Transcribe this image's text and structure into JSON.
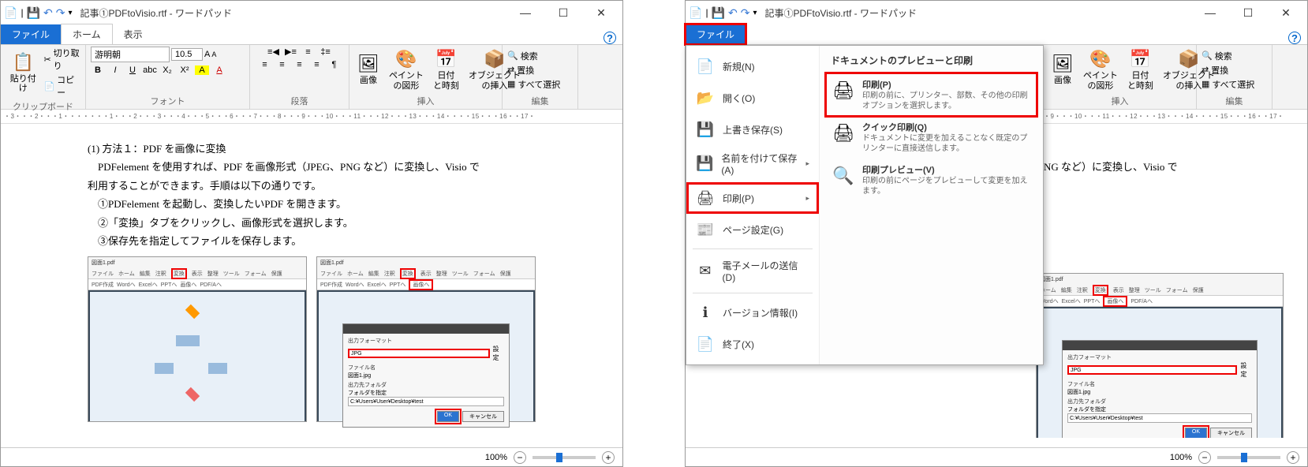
{
  "app_title": "記事①PDFtoVisio.rtf - ワードパッド",
  "tabs": {
    "file": "ファイル",
    "home": "ホーム",
    "view": "表示"
  },
  "ribbon": {
    "clipboard": {
      "paste": "貼り付け",
      "cut": "切り取り",
      "copy": "コピー",
      "label": "クリップボード"
    },
    "font": {
      "name": "游明朝",
      "size": "10.5",
      "label": "フォント"
    },
    "para": {
      "label": "段落"
    },
    "insert": {
      "image": "画像",
      "paint": "ペイント\nの図形",
      "date": "日付\nと時刻",
      "object": "オブジェクト\nの挿入",
      "label": "挿入"
    },
    "edit": {
      "find": "検索",
      "replace": "置換",
      "selectall": "すべて選択",
      "label": "編集"
    }
  },
  "ruler": "・3・・・2・・・1・・・・・・・1・・・2・・・3・・・4・・・5・・・6・・・7・・・8・・・9・・・10・・・11・・・12・・・13・・・14・・・・15・・・16・・17・",
  "doc": {
    "l1": "(1) 方法１：PDF を画像に変換",
    "l2": "　PDFelement を使用すれば、PDF を画像形式（JPEG、PNG など）に変換し、Visio で",
    "l3": "利用することができます。手順は以下の通りです。",
    "l4": "　①PDFelement を起動し、変換したいPDF を開きます。",
    "l5": "　②「変換」タブをクリックし、画像形式を選択します。",
    "l6": "　③保存先を指定してファイルを保存します。"
  },
  "doc2_visible": "NG など）に変換し、Visio で",
  "embed": {
    "title": "図面1.pdf",
    "menus": [
      "ファイル",
      "ホーム",
      "編集",
      "注釈",
      "変換",
      "表示",
      "整理",
      "ツール",
      "フォーム",
      "保護"
    ],
    "btns": [
      "PDF作成",
      "Wordへ",
      "Excelへ",
      "PPTへ",
      "画像へ",
      "PDF/Aへ"
    ],
    "hl_menu": "変換",
    "hl_btn": "画像へ",
    "dlg": {
      "fmt_label": "出力フォーマット",
      "fmt_val": "JPG",
      "fmt_set": "設定",
      "fname_label": "ファイル名",
      "fname_val": "図面1.jpg",
      "folder_label": "出力先フォルダ",
      "folder_opt": "フォルダを指定",
      "folder_val": "C:¥Users¥User¥Desktop¥test",
      "ok": "OK",
      "cancel": "キャンセル"
    }
  },
  "status": {
    "zoom": "100%"
  },
  "filemenu": {
    "right_title": "ドキュメントのプレビューと印刷",
    "items": {
      "new": "新規(N)",
      "open": "開く(O)",
      "save": "上書き保存(S)",
      "saveas": "名前を付けて保存(A)",
      "print": "印刷(P)",
      "pagesetup": "ページ設定(G)",
      "sendmail": "電子メールの送信(D)",
      "about": "バージョン情報(I)",
      "exit": "終了(X)"
    },
    "opts": {
      "print_t": "印刷(P)",
      "print_d": "印刷の前に、プリンター、部数、その他の印刷オプションを選択します。",
      "quick_t": "クイック印刷(Q)",
      "quick_d": "ドキュメントに変更を加えることなく既定のプリンターに直接送信します。",
      "preview_t": "印刷プレビュー(V)",
      "preview_d": "印刷の前にページをプレビューして変更を加えます。"
    }
  }
}
